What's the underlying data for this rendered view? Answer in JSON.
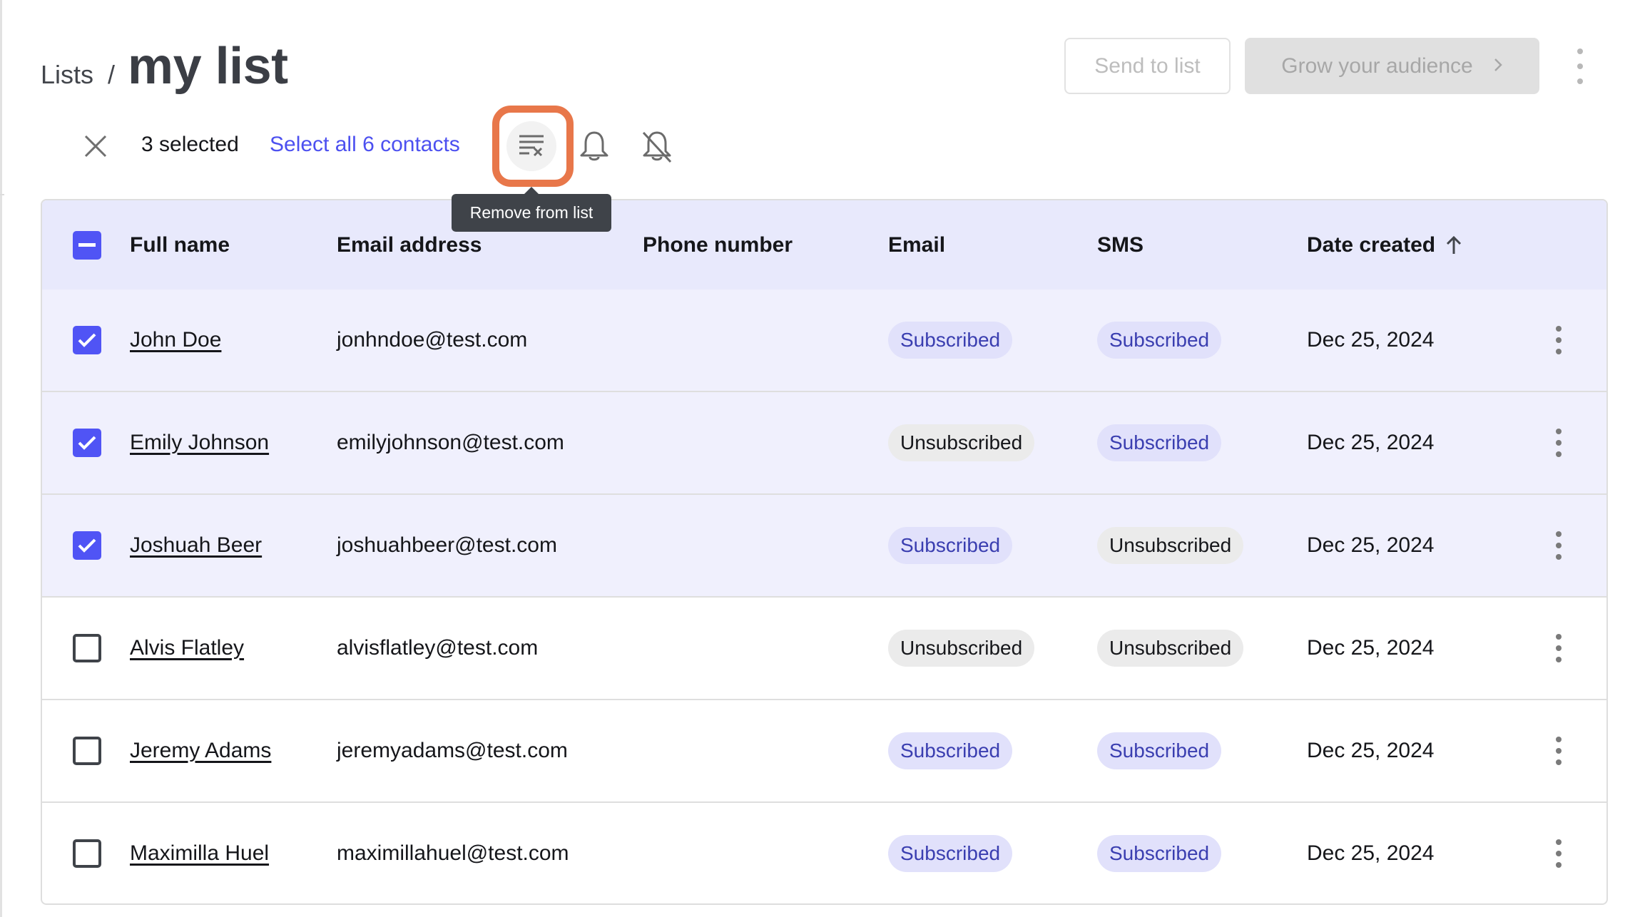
{
  "header": {
    "breadcrumb_parent": "Lists",
    "breadcrumb_separator": "/",
    "title": "my list",
    "send_button": "Send to list",
    "grow_button": "Grow your audience",
    "more_icon": "more-vertical-icon"
  },
  "selection_bar": {
    "clear_icon": "close-icon",
    "selected_text": "3 selected",
    "select_all_link": "Select all 6 contacts",
    "actions": [
      {
        "icon": "remove-from-list-icon",
        "tooltip": "Remove from list",
        "highlighted": true
      },
      {
        "icon": "bell-icon"
      },
      {
        "icon": "bell-off-icon"
      }
    ]
  },
  "tooltip": "Remove from list",
  "table": {
    "columns": [
      "Full name",
      "Email address",
      "Phone number",
      "Email",
      "SMS",
      "Date created"
    ],
    "sort": {
      "column": "Date created",
      "direction": "ascending",
      "icon": "arrow-up-icon"
    },
    "header_checkbox": "indeterminate",
    "rows": [
      {
        "selected": true,
        "name": "John Doe",
        "email": "jonhndoe@test.com",
        "phone": "",
        "email_status": "Subscribed",
        "sms_status": "Subscribed",
        "date": "Dec 25, 2024"
      },
      {
        "selected": true,
        "name": "Emily Johnson",
        "email": "emilyjohnson@test.com",
        "phone": "",
        "email_status": "Unsubscribed",
        "sms_status": "Subscribed",
        "date": "Dec 25, 2024"
      },
      {
        "selected": true,
        "name": "Joshuah Beer",
        "email": "joshuahbeer@test.com",
        "phone": "",
        "email_status": "Subscribed",
        "sms_status": "Unsubscribed",
        "date": "Dec 25, 2024"
      },
      {
        "selected": false,
        "name": "Alvis Flatley",
        "email": "alvisflatley@test.com",
        "phone": "",
        "email_status": "Unsubscribed",
        "sms_status": "Unsubscribed",
        "date": "Dec 25, 2024"
      },
      {
        "selected": false,
        "name": "Jeremy Adams",
        "email": "jeremyadams@test.com",
        "phone": "",
        "email_status": "Subscribed",
        "sms_status": "Subscribed",
        "date": "Dec 25, 2024"
      },
      {
        "selected": false,
        "name": "Maximilla Huel",
        "email": "maximillahuel@test.com",
        "phone": "",
        "email_status": "Subscribed",
        "sms_status": "Subscribed",
        "date": "Dec 25, 2024"
      }
    ]
  },
  "colors": {
    "accent": "#5054F5",
    "link": "#4C50F0",
    "highlight": "#E8774A",
    "header_bg": "#E8E9FC",
    "selected_row_bg": "#F0F0FD",
    "subscribed_bg": "#E1E1FB",
    "subscribed_text": "#3A3EB0",
    "unsubscribed_bg": "#EBEBEB",
    "tooltip_bg": "#3F4349"
  }
}
